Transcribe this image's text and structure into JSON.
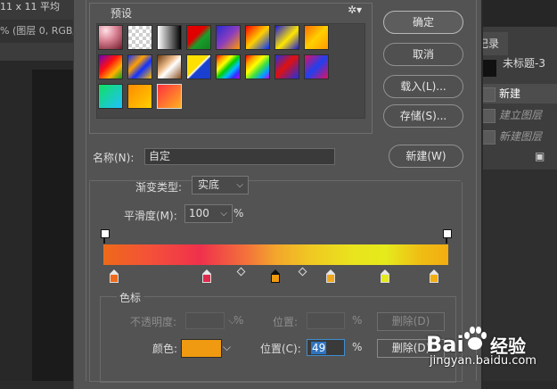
{
  "background": {
    "doc_title": "11 x 11 平均",
    "doc_info": "% (图层 0, RGB/",
    "history_tab": "记录",
    "history_title": "未标题-3",
    "history_items": [
      {
        "label": "新建",
        "state": "active"
      },
      {
        "label": "建立图层",
        "state": "dim"
      },
      {
        "label": "新建图层",
        "state": "dim"
      }
    ]
  },
  "presets": {
    "title": "预设",
    "gear_icon": "gear-icon"
  },
  "buttons": {
    "ok": "确定",
    "cancel": "取消",
    "load": "载入(L)...",
    "save": "存储(S)...",
    "new": "新建(W)"
  },
  "name_row": {
    "label": "名称(N):",
    "value": "自定"
  },
  "gradient": {
    "type_label": "渐变类型:",
    "type_value": "实底",
    "smooth_label": "平滑度(M):",
    "smooth_value": "100",
    "smooth_unit": "%",
    "bar_colors": [
      "#ee6a1a",
      "#f0304c",
      "#f3a62c",
      "#e5ea1c",
      "#f2ad10"
    ],
    "color_stops": [
      "#ee6a1a",
      "#e02a4a",
      "#ef9a10",
      "#f0a71c",
      "#e5ea1c",
      "#f2ad10"
    ]
  },
  "stops": {
    "title": "色标",
    "opacity_label": "不透明度:",
    "opacity_unit": "%",
    "opacity_location_label": "位置:",
    "opacity_location_unit": "%",
    "opacity_delete": "删除(D)",
    "color_label": "颜色:",
    "color_value": "#ef9a10",
    "location_label": "位置(C):",
    "location_value": "49",
    "location_unit": "%",
    "color_delete": "删除(D)"
  },
  "watermark": {
    "logo": "Bai",
    "logo_text": "经验",
    "url": "jingyan.baidu.com"
  }
}
